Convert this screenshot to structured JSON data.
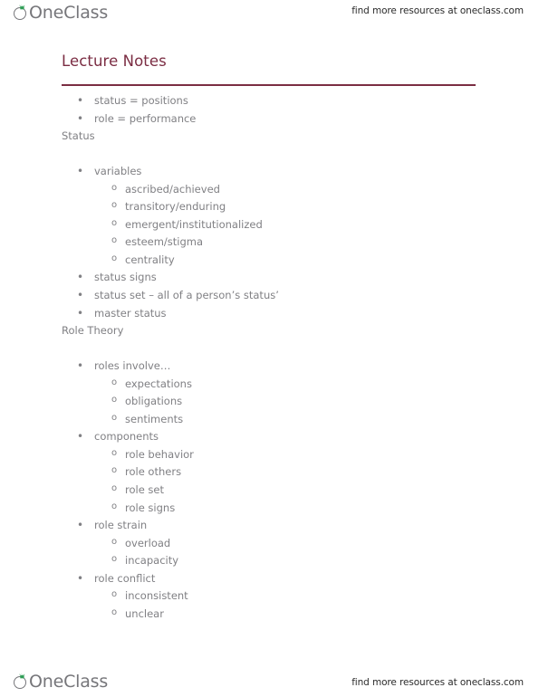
{
  "header": {
    "logo_text": "OneClass",
    "logo_icon": "oneclass-sprout-logo",
    "tagline": "find more resources at oneclass.com"
  },
  "document": {
    "title": "Lecture Notes",
    "title_color": "#7b2d43",
    "body_text_color": "#808084"
  },
  "footer": {
    "logo_text": "OneClass",
    "logo_icon": "oneclass-sprout-logo",
    "tagline": "find more resources at oneclass.com"
  },
  "outline": [
    {
      "level": 1,
      "marker": "•",
      "text": "status = positions"
    },
    {
      "level": 1,
      "marker": "•",
      "text": "role = performance"
    },
    {
      "level": 0,
      "marker": "",
      "text": "Status"
    },
    {
      "level": 1,
      "marker": "•",
      "text": "variables"
    },
    {
      "level": 2,
      "marker": "o",
      "text": "ascribed/achieved"
    },
    {
      "level": 2,
      "marker": "o",
      "text": "transitory/enduring"
    },
    {
      "level": 2,
      "marker": "o",
      "text": "emergent/institutionalized"
    },
    {
      "level": 2,
      "marker": "o",
      "text": "esteem/stigma"
    },
    {
      "level": 2,
      "marker": "o",
      "text": "centrality"
    },
    {
      "level": 1,
      "marker": "•",
      "text": "status signs"
    },
    {
      "level": 1,
      "marker": "•",
      "text": "status set – all of a person’s status’"
    },
    {
      "level": 1,
      "marker": "•",
      "text": "master status"
    },
    {
      "level": 0,
      "marker": "",
      "text": "Role Theory"
    },
    {
      "level": 1,
      "marker": "•",
      "text": "roles involve…"
    },
    {
      "level": 2,
      "marker": "o",
      "text": "expectations"
    },
    {
      "level": 2,
      "marker": "o",
      "text": "obligations"
    },
    {
      "level": 2,
      "marker": "o",
      "text": "sentiments"
    },
    {
      "level": 1,
      "marker": "•",
      "text": "components"
    },
    {
      "level": 2,
      "marker": "o",
      "text": "role behavior"
    },
    {
      "level": 2,
      "marker": "o",
      "text": "role others"
    },
    {
      "level": 2,
      "marker": "o",
      "text": "role set"
    },
    {
      "level": 2,
      "marker": "o",
      "text": "role signs"
    },
    {
      "level": 1,
      "marker": "•",
      "text": "role strain"
    },
    {
      "level": 2,
      "marker": "o",
      "text": "overload"
    },
    {
      "level": 2,
      "marker": "o",
      "text": "incapacity"
    },
    {
      "level": 1,
      "marker": "•",
      "text": "role conflict"
    },
    {
      "level": 2,
      "marker": "o",
      "text": "inconsistent"
    },
    {
      "level": 2,
      "marker": "o",
      "text": "unclear"
    }
  ]
}
